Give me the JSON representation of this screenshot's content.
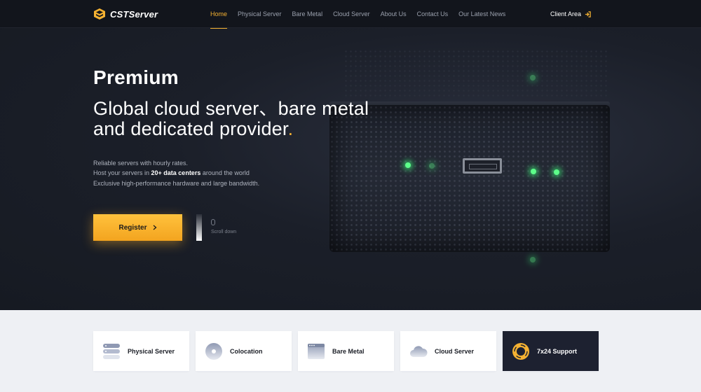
{
  "brand": {
    "name": "CSTServer",
    "accent": "#f5b232"
  },
  "nav": {
    "items": [
      {
        "label": "Home",
        "active": true
      },
      {
        "label": "Physical Server",
        "active": false
      },
      {
        "label": "Bare Metal",
        "active": false
      },
      {
        "label": "Cloud Server",
        "active": false
      },
      {
        "label": "About Us",
        "active": false
      },
      {
        "label": "Contact Us",
        "active": false
      },
      {
        "label": "Our Latest News",
        "active": false
      }
    ],
    "client_area": "Client Area",
    "client_area_icon": "login-arrow-icon"
  },
  "hero": {
    "title": "Premium",
    "line1": "Global cloud server、bare metal",
    "line2": "and dedicated provider",
    "line2_dot": ".",
    "desc1": "Reliable servers with hourly rates.",
    "desc2_pre": "Host your servers in ",
    "desc2_bold": "20+ data centers",
    "desc2_post": " around the world",
    "desc3": "Exclusive high-performance hardware and large bandwidth.",
    "register_label": "Register",
    "register_icon": "chevron-right-icon",
    "scroll_label": "Scroll down",
    "scroll_icon": "mouse-icon"
  },
  "cards": [
    {
      "label": "Physical Server",
      "icon": "server-stack-icon",
      "dark": false
    },
    {
      "label": "Colocation",
      "icon": "disc-icon",
      "dark": false
    },
    {
      "label": "Bare Metal",
      "icon": "browser-window-icon",
      "dark": false
    },
    {
      "label": "Cloud Server",
      "icon": "cloud-icon",
      "dark": false
    },
    {
      "label": "7x24 Support",
      "icon": "lifebuoy-icon",
      "dark": true
    }
  ]
}
